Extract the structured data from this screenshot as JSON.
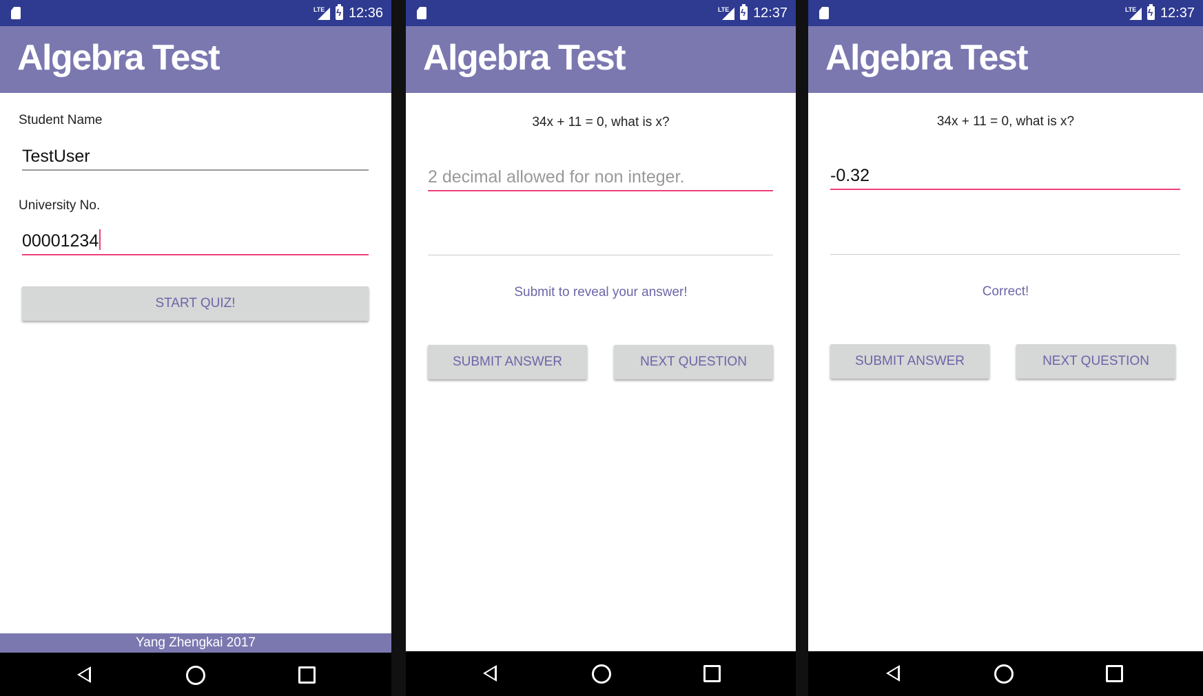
{
  "screens": [
    {
      "status": {
        "time": "12:36",
        "network": "LTE"
      },
      "app_title": "Algebra Test",
      "student_name_label": "Student Name",
      "student_name_value": "TestUser",
      "university_no_label": "University No.",
      "university_no_value": "00001234",
      "start_button": "START QUIZ!",
      "footer": "Yang Zhengkai  2017"
    },
    {
      "status": {
        "time": "12:37",
        "network": "LTE"
      },
      "app_title": "Algebra Test",
      "question": "34x + 11 = 0, what is x?",
      "answer_placeholder": "2 decimal allowed for non integer.",
      "feedback": "Submit to reveal your answer!",
      "submit_button": "SUBMIT ANSWER",
      "next_button": "NEXT QUESTION"
    },
    {
      "status": {
        "time": "12:37",
        "network": "LTE"
      },
      "app_title": "Algebra Test",
      "question": "34x + 11 = 0, what is x?",
      "answer_value": "-0.32",
      "feedback": "Correct!",
      "submit_button": "SUBMIT ANSWER",
      "next_button": "NEXT QUESTION"
    }
  ],
  "colors": {
    "status_bar": "#2f3a91",
    "app_bar": "#7b78b0",
    "accent": "#ec407a",
    "button_bg": "#d6d7d7",
    "button_text": "#6a66a8"
  },
  "icons": [
    "sd-card-icon",
    "lte-signal-icon",
    "battery-charging-icon",
    "nav-back-icon",
    "nav-home-icon",
    "nav-recents-icon"
  ]
}
